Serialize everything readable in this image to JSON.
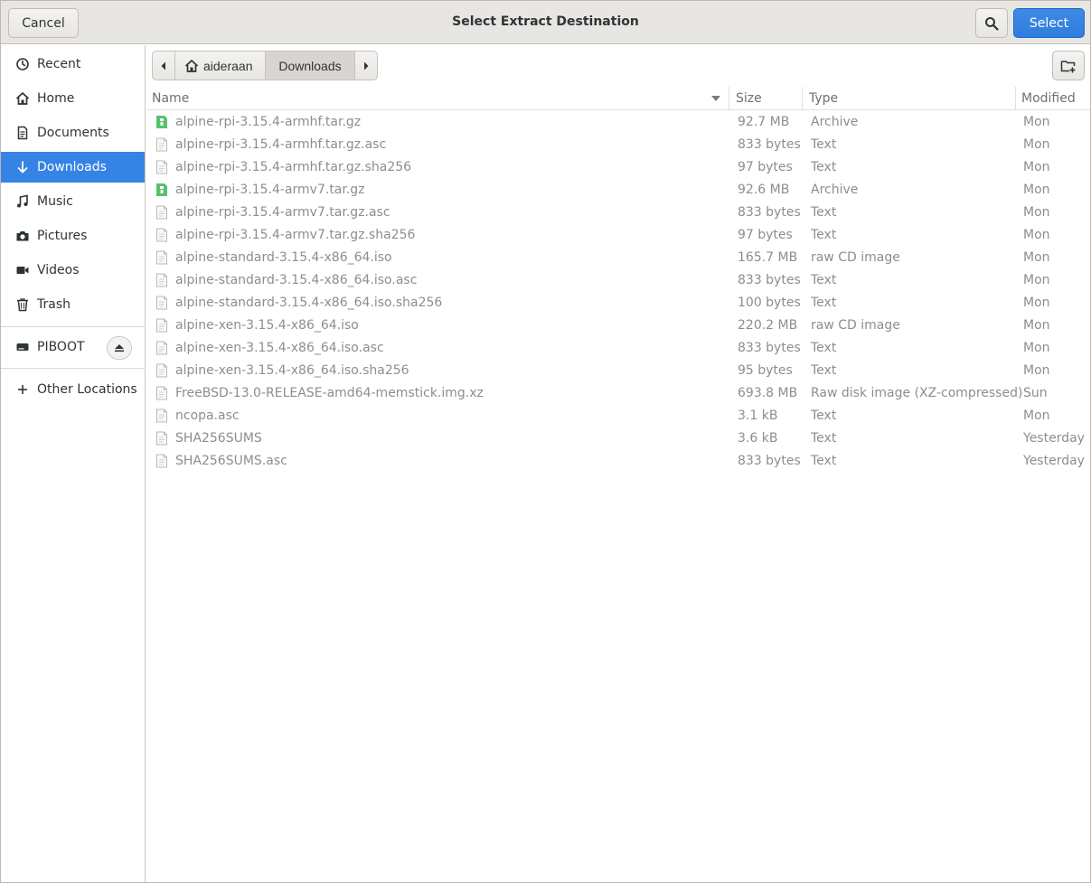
{
  "header": {
    "cancel_label": "Cancel",
    "title": "Select Extract Destination",
    "select_label": "Select"
  },
  "sidebar": {
    "items": [
      {
        "label": "Recent",
        "icon": "clock-icon"
      },
      {
        "label": "Home",
        "icon": "home-icon"
      },
      {
        "label": "Documents",
        "icon": "document-icon"
      },
      {
        "label": "Downloads",
        "icon": "download-icon"
      },
      {
        "label": "Music",
        "icon": "music-note-icon"
      },
      {
        "label": "Pictures",
        "icon": "camera-icon"
      },
      {
        "label": "Videos",
        "icon": "video-camera-icon"
      },
      {
        "label": "Trash",
        "icon": "trash-icon"
      }
    ],
    "device": {
      "label": "PIBOOT",
      "icon": "drive-icon"
    },
    "other": {
      "label": "Other Locations",
      "icon": "plus-icon"
    },
    "active_index": 3
  },
  "pathbar": {
    "home_label": "aideraan",
    "current_label": "Downloads"
  },
  "columns": {
    "name": "Name",
    "size": "Size",
    "type": "Type",
    "modified": "Modified"
  },
  "files": [
    {
      "name": "alpine-rpi-3.15.4-armhf.tar.gz",
      "size": "92.7 MB",
      "type": "Archive",
      "modified": "Mon",
      "icon": "archive-icon"
    },
    {
      "name": "alpine-rpi-3.15.4-armhf.tar.gz.asc",
      "size": "833 bytes",
      "type": "Text",
      "modified": "Mon",
      "icon": "text-file-icon"
    },
    {
      "name": "alpine-rpi-3.15.4-armhf.tar.gz.sha256",
      "size": "97 bytes",
      "type": "Text",
      "modified": "Mon",
      "icon": "text-file-icon"
    },
    {
      "name": "alpine-rpi-3.15.4-armv7.tar.gz",
      "size": "92.6 MB",
      "type": "Archive",
      "modified": "Mon",
      "icon": "archive-icon"
    },
    {
      "name": "alpine-rpi-3.15.4-armv7.tar.gz.asc",
      "size": "833 bytes",
      "type": "Text",
      "modified": "Mon",
      "icon": "text-file-icon"
    },
    {
      "name": "alpine-rpi-3.15.4-armv7.tar.gz.sha256",
      "size": "97 bytes",
      "type": "Text",
      "modified": "Mon",
      "icon": "text-file-icon"
    },
    {
      "name": "alpine-standard-3.15.4-x86_64.iso",
      "size": "165.7 MB",
      "type": "raw CD image",
      "modified": "Mon",
      "icon": "text-file-icon"
    },
    {
      "name": "alpine-standard-3.15.4-x86_64.iso.asc",
      "size": "833 bytes",
      "type": "Text",
      "modified": "Mon",
      "icon": "text-file-icon"
    },
    {
      "name": "alpine-standard-3.15.4-x86_64.iso.sha256",
      "size": "100 bytes",
      "type": "Text",
      "modified": "Mon",
      "icon": "text-file-icon"
    },
    {
      "name": "alpine-xen-3.15.4-x86_64.iso",
      "size": "220.2 MB",
      "type": "raw CD image",
      "modified": "Mon",
      "icon": "text-file-icon"
    },
    {
      "name": "alpine-xen-3.15.4-x86_64.iso.asc",
      "size": "833 bytes",
      "type": "Text",
      "modified": "Mon",
      "icon": "text-file-icon"
    },
    {
      "name": "alpine-xen-3.15.4-x86_64.iso.sha256",
      "size": "95 bytes",
      "type": "Text",
      "modified": "Mon",
      "icon": "text-file-icon"
    },
    {
      "name": "FreeBSD-13.0-RELEASE-amd64-memstick.img.xz",
      "size": "693.8 MB",
      "type": "Raw disk image (XZ-compressed)",
      "modified": "Sun",
      "icon": "text-file-icon"
    },
    {
      "name": "ncopa.asc",
      "size": "3.1 kB",
      "type": "Text",
      "modified": "Mon",
      "icon": "text-file-icon"
    },
    {
      "name": "SHA256SUMS",
      "size": "3.6 kB",
      "type": "Text",
      "modified": "Yesterday",
      "icon": "text-file-icon"
    },
    {
      "name": "SHA256SUMS.asc",
      "size": "833 bytes",
      "type": "Text",
      "modified": "Yesterday",
      "icon": "text-file-icon"
    }
  ],
  "colors": {
    "accent": "#3584e4",
    "archive_icon": "#57c16e"
  }
}
